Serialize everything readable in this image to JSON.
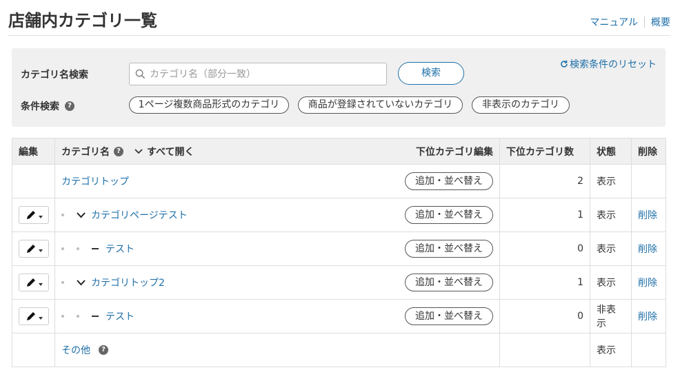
{
  "header": {
    "title": "店舗内カテゴリ一覧",
    "links": [
      {
        "label": "マニュアル"
      },
      {
        "label": "概要"
      }
    ]
  },
  "search": {
    "name_label": "カテゴリ名検索",
    "placeholder": "カテゴリ名（部分一致）",
    "value": "",
    "button_label": "検索",
    "reset_label": "検索条件のリセット",
    "condition_label": "条件検索",
    "chips": [
      {
        "label": "1ページ複数商品形式のカテゴリ"
      },
      {
        "label": "商品が登録されていないカテゴリ"
      },
      {
        "label": "非表示のカテゴリ"
      }
    ]
  },
  "table": {
    "headers": {
      "edit": "編集",
      "name": "カテゴリ名",
      "expand_all": "すべて開く",
      "sub_edit": "下位カテゴリ編集",
      "sub_count": "下位カテゴリ数",
      "state": "状態",
      "delete": "削除"
    },
    "rows": [
      {
        "name": "カテゴリトップ",
        "action": "追加・並べ替え",
        "count": "2",
        "state": "表示",
        "delete": ""
      },
      {
        "name": "カテゴリページテスト",
        "action": "追加・並べ替え",
        "count": "1",
        "state": "表示",
        "delete": "削除"
      },
      {
        "name": "テスト",
        "action": "追加・並べ替え",
        "count": "0",
        "state": "表示",
        "delete": "削除"
      },
      {
        "name": "カテゴリトップ2",
        "action": "追加・並べ替え",
        "count": "1",
        "state": "表示",
        "delete": "削除"
      },
      {
        "name": "テスト",
        "action": "追加・並べ替え",
        "count": "0",
        "state": "非表示",
        "delete": "削除"
      },
      {
        "name": "その他",
        "action": "",
        "count": "",
        "state": "表示",
        "delete": ""
      }
    ]
  },
  "colors": {
    "link": "#1e6fa8",
    "panel_bg": "#f0f0f0",
    "border": "#dddddd"
  }
}
